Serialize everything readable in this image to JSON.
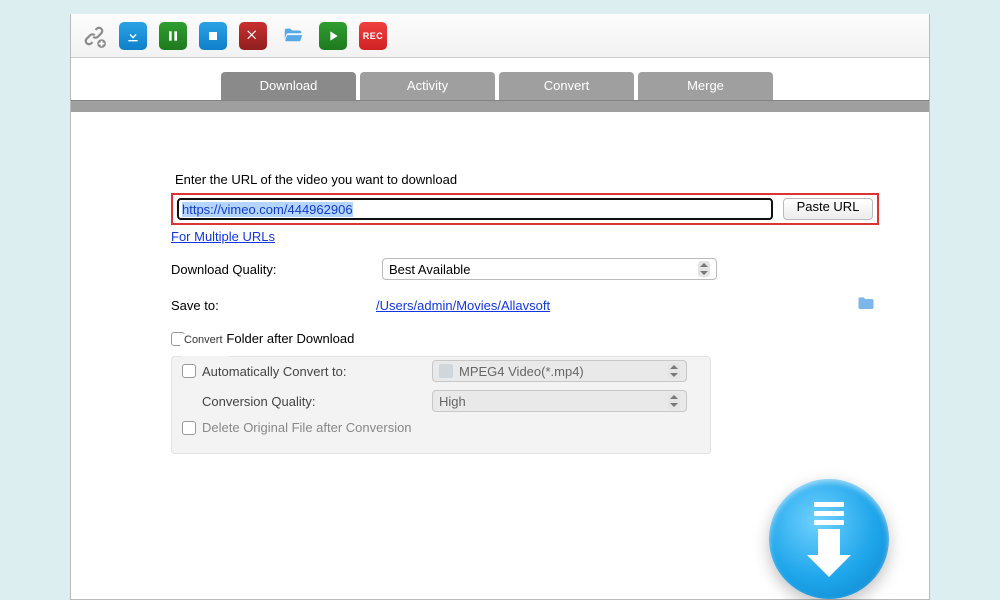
{
  "toolbar": {
    "icons": {
      "link": "link-icon",
      "download": "download-icon",
      "pause": "pause-icon",
      "stop": "stop-icon",
      "delete": "delete-icon",
      "open_folder": "folder-open-icon",
      "play": "play-icon",
      "record": "REC"
    }
  },
  "tabs": [
    {
      "id": "download",
      "label": "Download",
      "active": true
    },
    {
      "id": "activity",
      "label": "Activity",
      "active": false
    },
    {
      "id": "convert",
      "label": "Convert",
      "active": false
    },
    {
      "id": "merge",
      "label": "Merge",
      "active": false
    }
  ],
  "main": {
    "prompt": "Enter the URL of the video you want to download",
    "url_value": "https://vimeo.com/444962906",
    "paste_btn": "Paste URL",
    "multi_link": "For Multiple URLs",
    "quality_label": "Download Quality:",
    "quality_value": "Best Available",
    "save_label": "Save to:",
    "save_path": "/Users/admin/Movies/Allavsoft",
    "open_after": "Open Folder after Download",
    "convert": {
      "legend": "Convert",
      "auto_label": "Automatically Convert to:",
      "format_value": "MPEG4 Video(*.mp4)",
      "quality_label": "Conversion Quality:",
      "quality_value": "High",
      "delete_label": "Delete Original File after Conversion"
    }
  }
}
